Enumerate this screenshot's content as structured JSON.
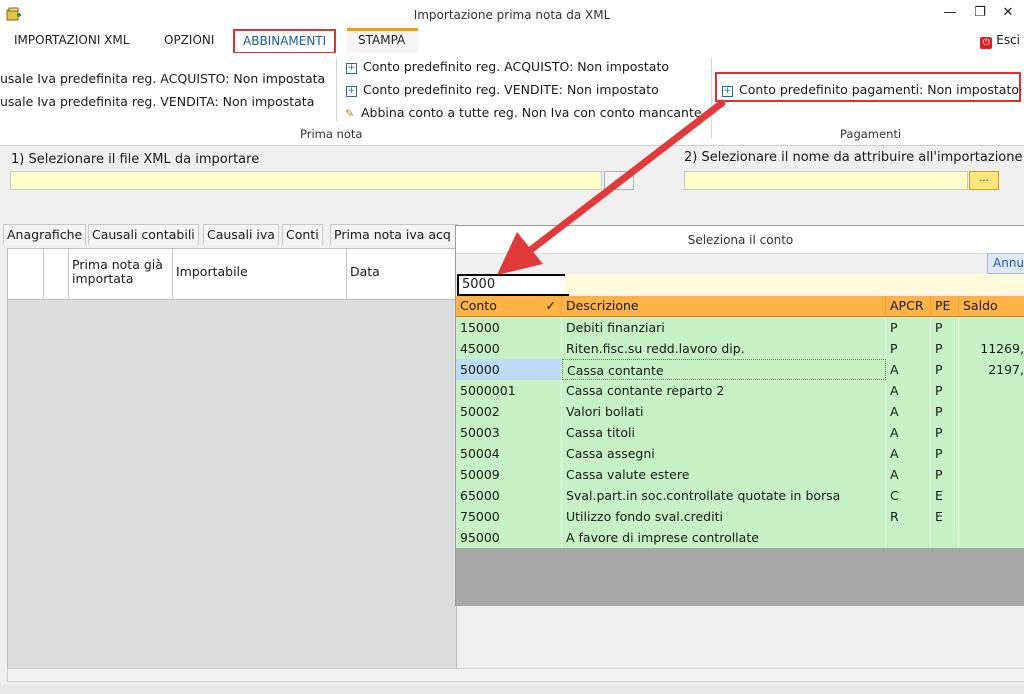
{
  "window": {
    "title": "Importazione prima nota da XML",
    "minimize": "—",
    "restore": "❐",
    "close": "✕"
  },
  "tabs": [
    {
      "label": "IMPORTAZIONI XML"
    },
    {
      "label": "OPZIONI"
    },
    {
      "label": "ABBINAMENTI"
    },
    {
      "label": "STAMPA"
    }
  ],
  "esci": {
    "label": "Esci",
    "icon": "exit-icon"
  },
  "ribbon": {
    "prima_nota": {
      "causale_acquisto": "usale Iva predefinita reg. ACQUISTO: Non impostata",
      "causale_vendita": "usale Iva predefinita reg. VENDITA: Non impostata",
      "conto_acquisto": "Conto predefinito reg. ACQUISTO: Non impostato",
      "conto_vendite": "Conto predefinito reg. VENDITE: Non impostato",
      "abbina_conto": "Abbina conto a tutte reg. Non Iva con conto mancante",
      "group_label": "Prima nota"
    },
    "pagamenti": {
      "conto_pagamenti": "Conto predefinito pagamenti: Non impostato",
      "group_label": "Pagamenti"
    }
  },
  "step1": {
    "label": "1) Selezionare il file XML da importare",
    "value": "",
    "browse": "..."
  },
  "step2": {
    "label": "2) Selezionare il nome da attribuire all'importazione",
    "value": "",
    "browse": "..."
  },
  "lower_tabs": [
    "Anagrafiche",
    "Causali contabili",
    "Causali iva",
    "Conti",
    "Prima nota iva acq"
  ],
  "grid": {
    "headers": [
      "",
      "",
      "Prima nota già importata",
      "Importabile",
      "Data"
    ]
  },
  "popup": {
    "title": "Seleziona il conto",
    "annulla": "Annu",
    "search": "5000",
    "columns": [
      "Conto",
      "Descrizione",
      "APCR",
      "PE",
      "Saldo"
    ],
    "sort_mark": "✓",
    "rows": [
      {
        "conto": "15000",
        "descrizione": "Debiti finanziari",
        "apcr": "P",
        "pe": "P",
        "saldo": ""
      },
      {
        "conto": "45000",
        "descrizione": "Riten.fisc.su redd.lavoro dip.",
        "apcr": "P",
        "pe": "P",
        "saldo": "11269,"
      },
      {
        "conto": "50000",
        "descrizione": "Cassa contante",
        "apcr": "A",
        "pe": "P",
        "saldo": "2197,"
      },
      {
        "conto": "5000001",
        "descrizione": "Cassa contante reparto 2",
        "apcr": "A",
        "pe": "P",
        "saldo": ""
      },
      {
        "conto": "50002",
        "descrizione": "Valori bollati",
        "apcr": "A",
        "pe": "P",
        "saldo": ""
      },
      {
        "conto": "50003",
        "descrizione": "Cassa titoli",
        "apcr": "A",
        "pe": "P",
        "saldo": ""
      },
      {
        "conto": "50004",
        "descrizione": "Cassa assegni",
        "apcr": "A",
        "pe": "P",
        "saldo": ""
      },
      {
        "conto": "50009",
        "descrizione": "Cassa valute estere",
        "apcr": "A",
        "pe": "P",
        "saldo": ""
      },
      {
        "conto": "65000",
        "descrizione": "Sval.part.in soc.controllate quotate in borsa",
        "apcr": "C",
        "pe": "E",
        "saldo": ""
      },
      {
        "conto": "75000",
        "descrizione": "Utilizzo fondo sval.crediti",
        "apcr": "R",
        "pe": "E",
        "saldo": ""
      },
      {
        "conto": "95000",
        "descrizione": "A favore di imprese controllate",
        "apcr": "",
        "pe": "",
        "saldo": ""
      }
    ],
    "selected_row": 2
  },
  "colors": {
    "accent_red": "#e03030",
    "header_orange": "#ffb347",
    "row_green": "#c6f2c6",
    "selected_blue": "#bcdcf7",
    "input_yellow": "#ffffcc"
  }
}
